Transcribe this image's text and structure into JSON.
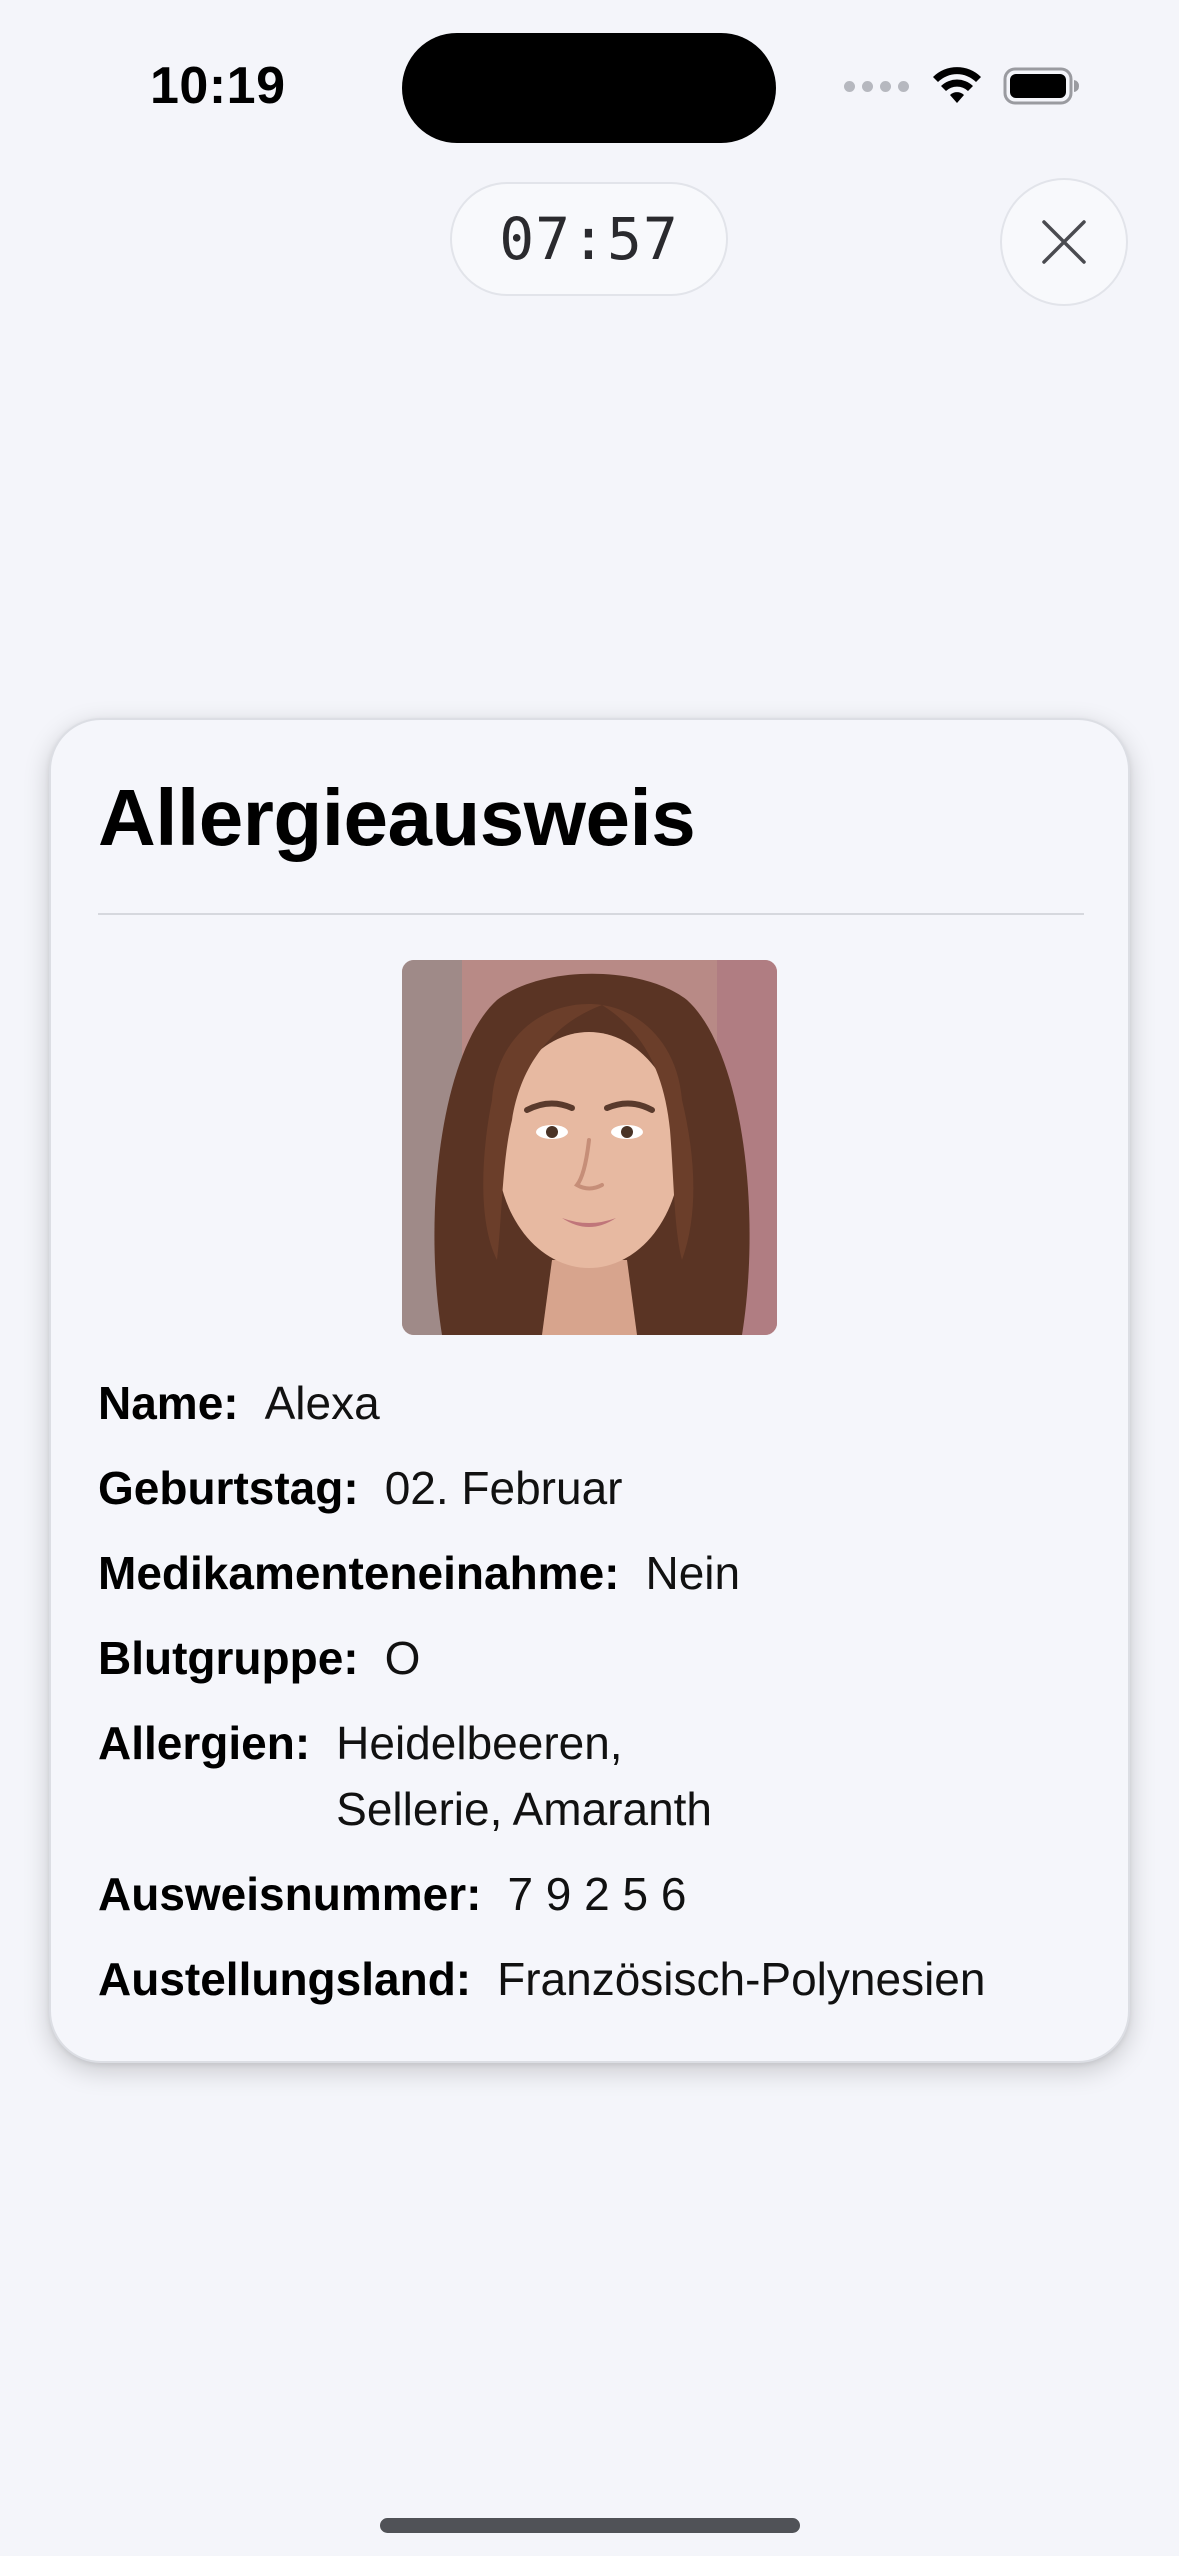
{
  "status_bar": {
    "time": "10:19"
  },
  "timer": {
    "value": "07:57"
  },
  "card": {
    "title": "Allergieausweis",
    "fields": {
      "name": {
        "label": "Name:",
        "value": "Alexa"
      },
      "birthday": {
        "label": "Geburtstag:",
        "value": "02. Februar"
      },
      "medication": {
        "label": "Medikamenteneinahme:",
        "value": "Nein"
      },
      "blood_type": {
        "label": "Blutgruppe:",
        "value": "O"
      },
      "allergies": {
        "label": "Allergien:",
        "value": "Heidelbeeren, Sellerie, Amaranth"
      },
      "id_number": {
        "label": "Ausweisnummer:",
        "value": "7 9 2 5 6"
      },
      "issuing_country": {
        "label": "Austellungsland:",
        "value": "Französisch-Polynesien"
      }
    }
  },
  "icons": {
    "close": "close-icon",
    "wifi": "wifi-icon",
    "battery": "battery-icon",
    "cellular": "cellular-dots-icon"
  }
}
